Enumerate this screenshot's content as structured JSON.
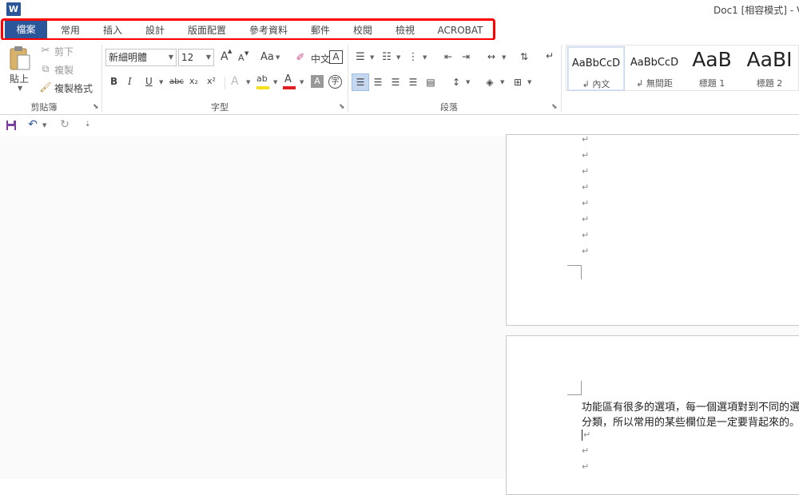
{
  "window": {
    "app_icon": "W",
    "title": "Doc1 [相容模式] - V"
  },
  "tabs": [
    {
      "label": "檔案"
    },
    {
      "label": "常用"
    },
    {
      "label": "插入"
    },
    {
      "label": "設計"
    },
    {
      "label": "版面配置"
    },
    {
      "label": "參考資料"
    },
    {
      "label": "郵件"
    },
    {
      "label": "校閱"
    },
    {
      "label": "檢視"
    },
    {
      "label": "ACROBAT"
    }
  ],
  "ribbon": {
    "clipboard": {
      "paste_label": "貼上",
      "cut_label": "剪下",
      "copy_label": "複製",
      "format_painter_label": "複製格式",
      "group_label": "剪貼簿"
    },
    "font": {
      "font_name": "新細明體",
      "font_size": "12",
      "grow_label": "A",
      "shrink_label": "A",
      "change_case_label": "Aa",
      "bold_label": "B",
      "italic_label": "I",
      "underline_label": "U",
      "strike_label": "abc",
      "subscript_label": "x₂",
      "superscript_label": "x²",
      "text_effect_label": "A",
      "highlight_label": "ab",
      "font_color_label": "A",
      "char_shading_label": "A",
      "enclose_label": "字",
      "phonetic_label": "中文",
      "char_border_label": "A",
      "group_label": "字型"
    },
    "paragraph": {
      "group_label": "段落"
    },
    "styles": {
      "items": [
        {
          "sample": "AaBbCcD",
          "name": "內文",
          "selected": true
        },
        {
          "sample": "AaBbCcD",
          "name": "無間距",
          "selected": false
        },
        {
          "sample": "AaB",
          "name": "標題 1",
          "selected": false
        },
        {
          "sample": "AaBI",
          "name": "標題 2",
          "selected": false
        }
      ]
    }
  },
  "document": {
    "page1_marks": [
      "↵",
      "↵",
      "↵",
      "↵",
      "↵",
      "↵",
      "↵",
      "↵"
    ],
    "page2": {
      "line1": "功能區有很多的選項，每一個選項對到不同的選項",
      "line2": "分類，所以常用的某些欄位是一定要背起來的。↵",
      "marks": [
        "↵",
        "↵",
        "↵"
      ]
    }
  },
  "colors": {
    "accent": "#2b579a",
    "highlight_box": "#ff0000",
    "highlight_yellow": "#f5e11a",
    "font_red": "#e02020"
  }
}
